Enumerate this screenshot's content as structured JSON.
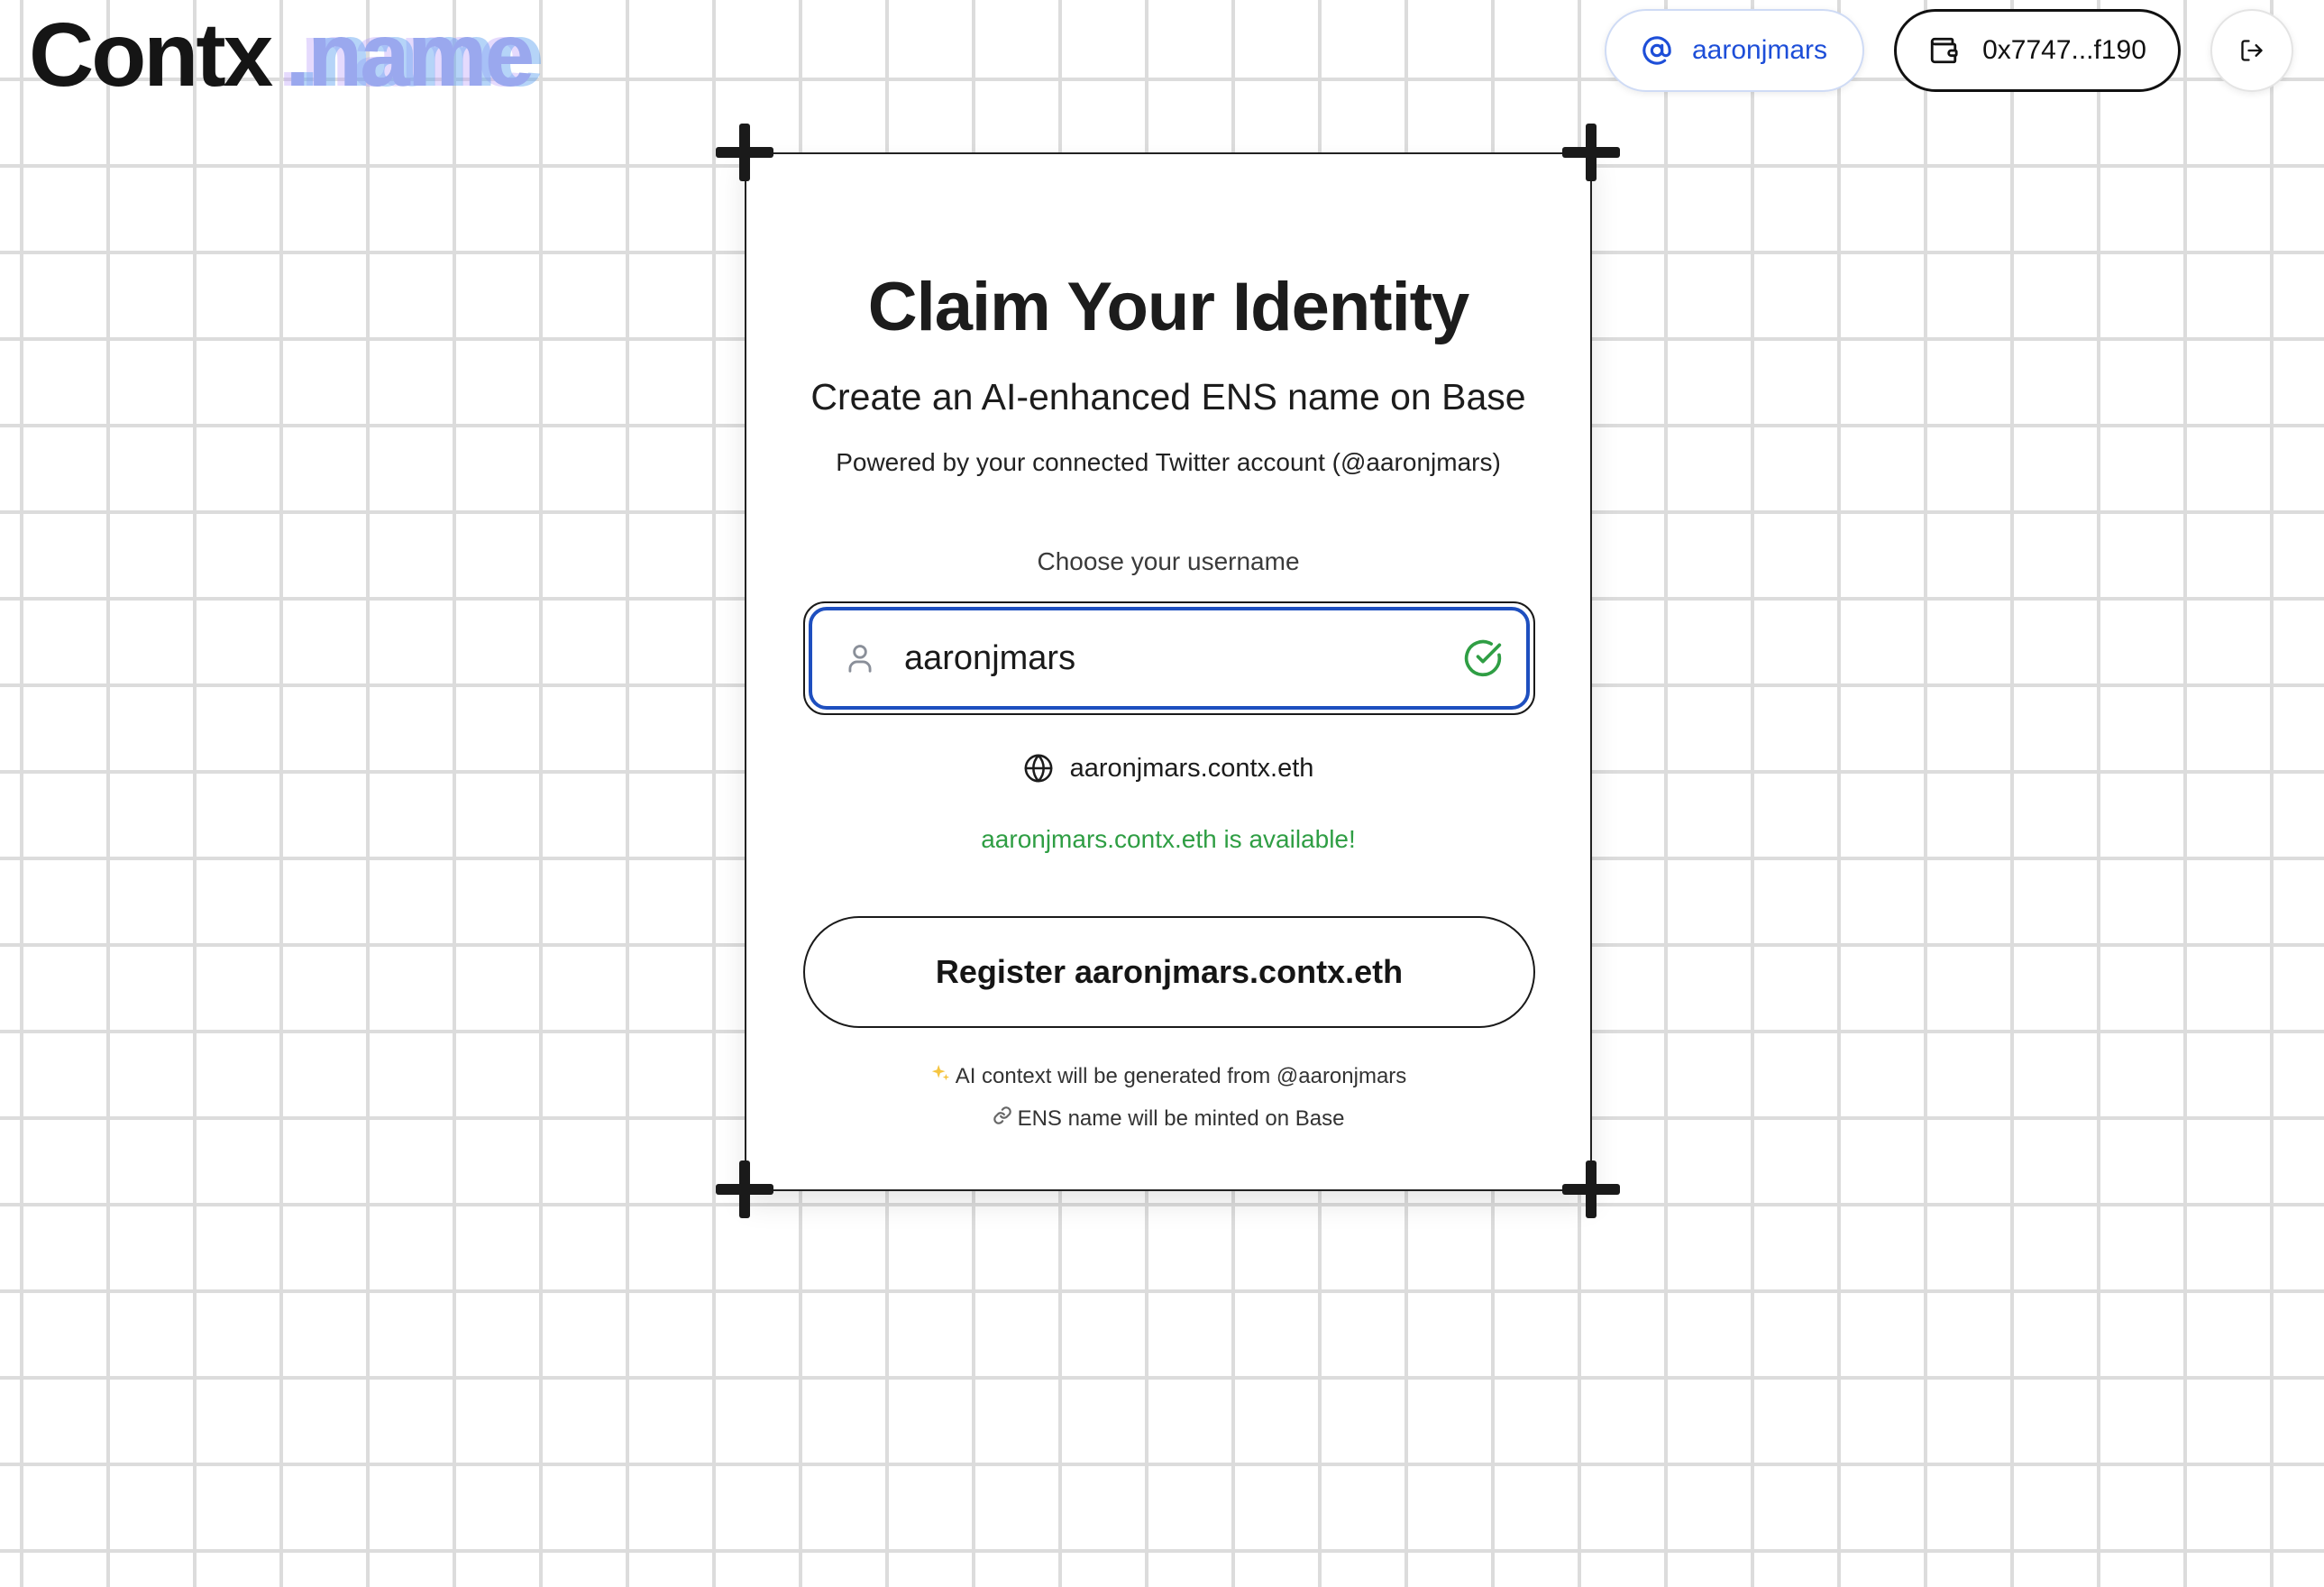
{
  "header": {
    "logo_brand": "Contx",
    "logo_tld": ".name",
    "twitter_handle": "aaronjmars",
    "wallet_address": "0x7747...f190"
  },
  "card": {
    "title": "Claim Your Identity",
    "subtitle": "Create an AI-enhanced ENS name on Base",
    "powered_by": "Powered by your connected Twitter account (@aaronjmars)",
    "username_label": "Choose your username",
    "username_value": "aaronjmars",
    "ens_preview": "aaronjmars.contx.eth",
    "availability_message": "aaronjmars.contx.eth is available!",
    "register_button": "Register aaronjmars.contx.eth",
    "note_ai": "AI context will be generated from @aaronjmars",
    "note_mint": "ENS name will be minted on Base"
  },
  "colors": {
    "accent_blue": "#1d4ed8",
    "success_green": "#2f9e44",
    "logo_tld": "#9aa8ee"
  },
  "icons": {
    "user_pill": "at-icon",
    "wallet_pill": "wallet-icon",
    "logout": "logout-icon",
    "input_left": "user-icon",
    "input_right": "check-circle-icon",
    "ens": "globe-icon",
    "note_ai": "sparkles-icon",
    "note_mint": "link-icon"
  }
}
